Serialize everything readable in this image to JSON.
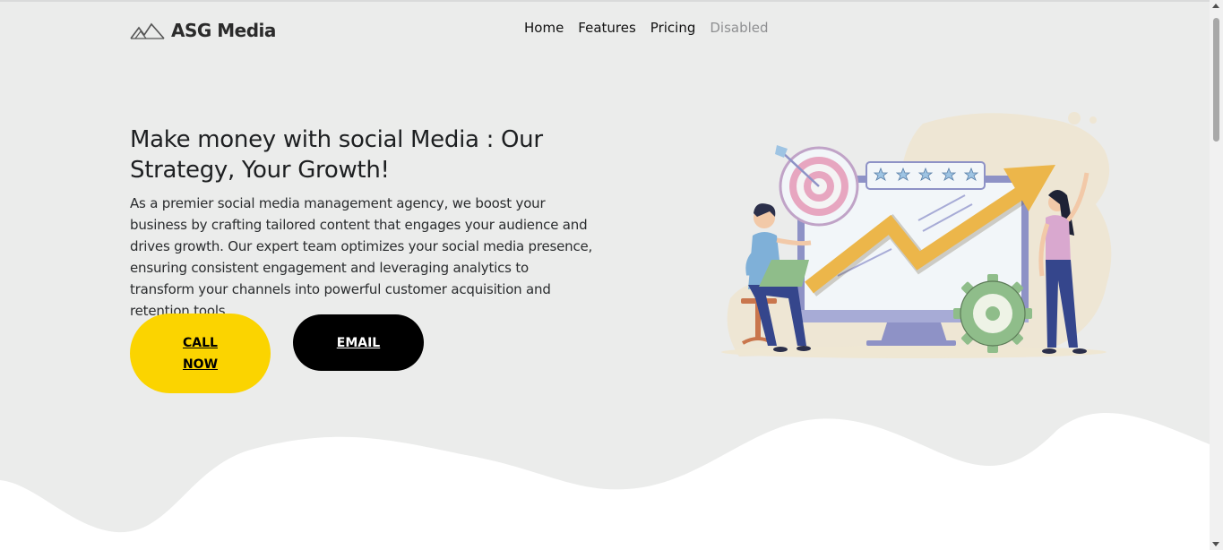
{
  "brand": {
    "name": "ASG Media",
    "icon": "mountains-logo-icon"
  },
  "nav": {
    "items": [
      {
        "label": "Home",
        "state": "active"
      },
      {
        "label": "Features",
        "state": "normal"
      },
      {
        "label": "Pricing",
        "state": "normal"
      },
      {
        "label": "Disabled",
        "state": "disabled"
      }
    ]
  },
  "hero": {
    "headline": "Make money with social Media : Our Strategy, Your Growth!",
    "description": "As a premier social media management agency, we boost your business by crafting tailored content that engages your audience and drives growth. Our expert team optimizes your social media presence, ensuring consistent engagement and leveraging analytics to transform your channels into powerful customer acquisition and retention tools.",
    "call_button": "CALL NOW",
    "email_button": "EMAIL",
    "illustration": "growth-chart-illustration"
  },
  "colors": {
    "background": "#ebeceb",
    "call_button": "#fbd400",
    "email_button": "#000000",
    "accent_arrow": "#ecb64a",
    "monitor": "#8e92c6"
  }
}
